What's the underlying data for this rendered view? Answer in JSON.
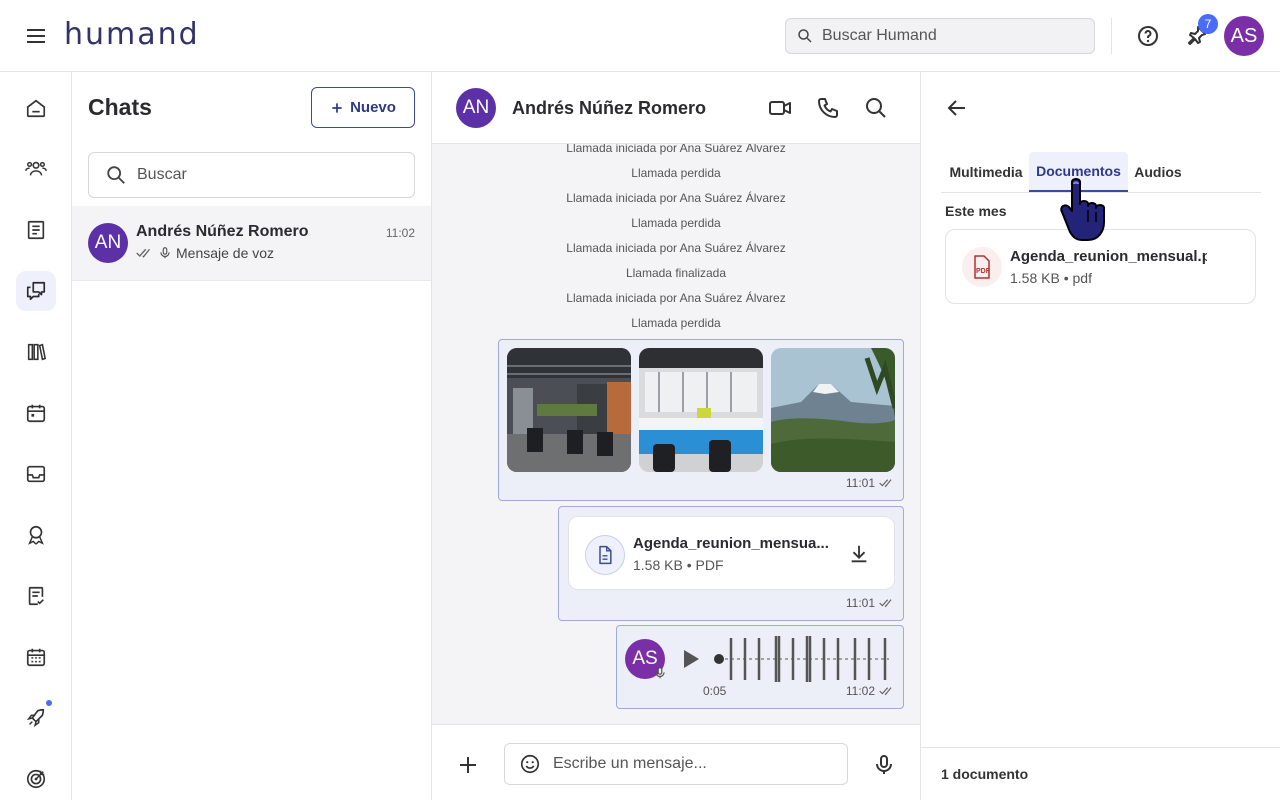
{
  "topbar": {
    "logo": "humand",
    "search_placeholder": "Buscar Humand",
    "notifications_count": "7",
    "user_initials": "AS"
  },
  "chatlist": {
    "title": "Chats",
    "new_button": "Nuevo",
    "search_placeholder": "Buscar",
    "items": [
      {
        "initials": "AN",
        "name": "Andrés Núñez Romero",
        "time": "11:02",
        "preview": "Mensaje de voz"
      }
    ]
  },
  "conversation": {
    "initials": "AN",
    "name": "Andrés Núñez Romero",
    "system_messages": [
      "Llamada iniciada por Ana Suárez Álvarez",
      "Llamada perdida",
      "Llamada iniciada por Ana Suárez Álvarez",
      "Llamada perdida",
      "Llamada iniciada por Ana Suárez Álvarez",
      "Llamada finalizada",
      "Llamada iniciada por Ana Suárez Álvarez",
      "Llamada perdida"
    ],
    "images_message": {
      "time": "11:01"
    },
    "document_message": {
      "name": "Agenda_reunion_mensua...",
      "meta": "1.58 KB • PDF",
      "time": "11:01"
    },
    "voice_message": {
      "initials": "AS",
      "duration": "0:05",
      "time": "11:02"
    },
    "composer_placeholder": "Escribe un mensaje..."
  },
  "details": {
    "tabs": [
      "Multimedia",
      "Documentos",
      "Audios"
    ],
    "active_tab": "Documentos",
    "section": "Este mes",
    "file": {
      "name": "Agenda_reunion_mensual.pdf",
      "meta": "1.58 KB • pdf"
    },
    "count_label": "1 documento"
  },
  "colors": {
    "accent": "#3c4b99",
    "avatar_as": "#7b2fa7",
    "avatar_an": "#5c31a8",
    "badge": "#4a6cf7"
  }
}
